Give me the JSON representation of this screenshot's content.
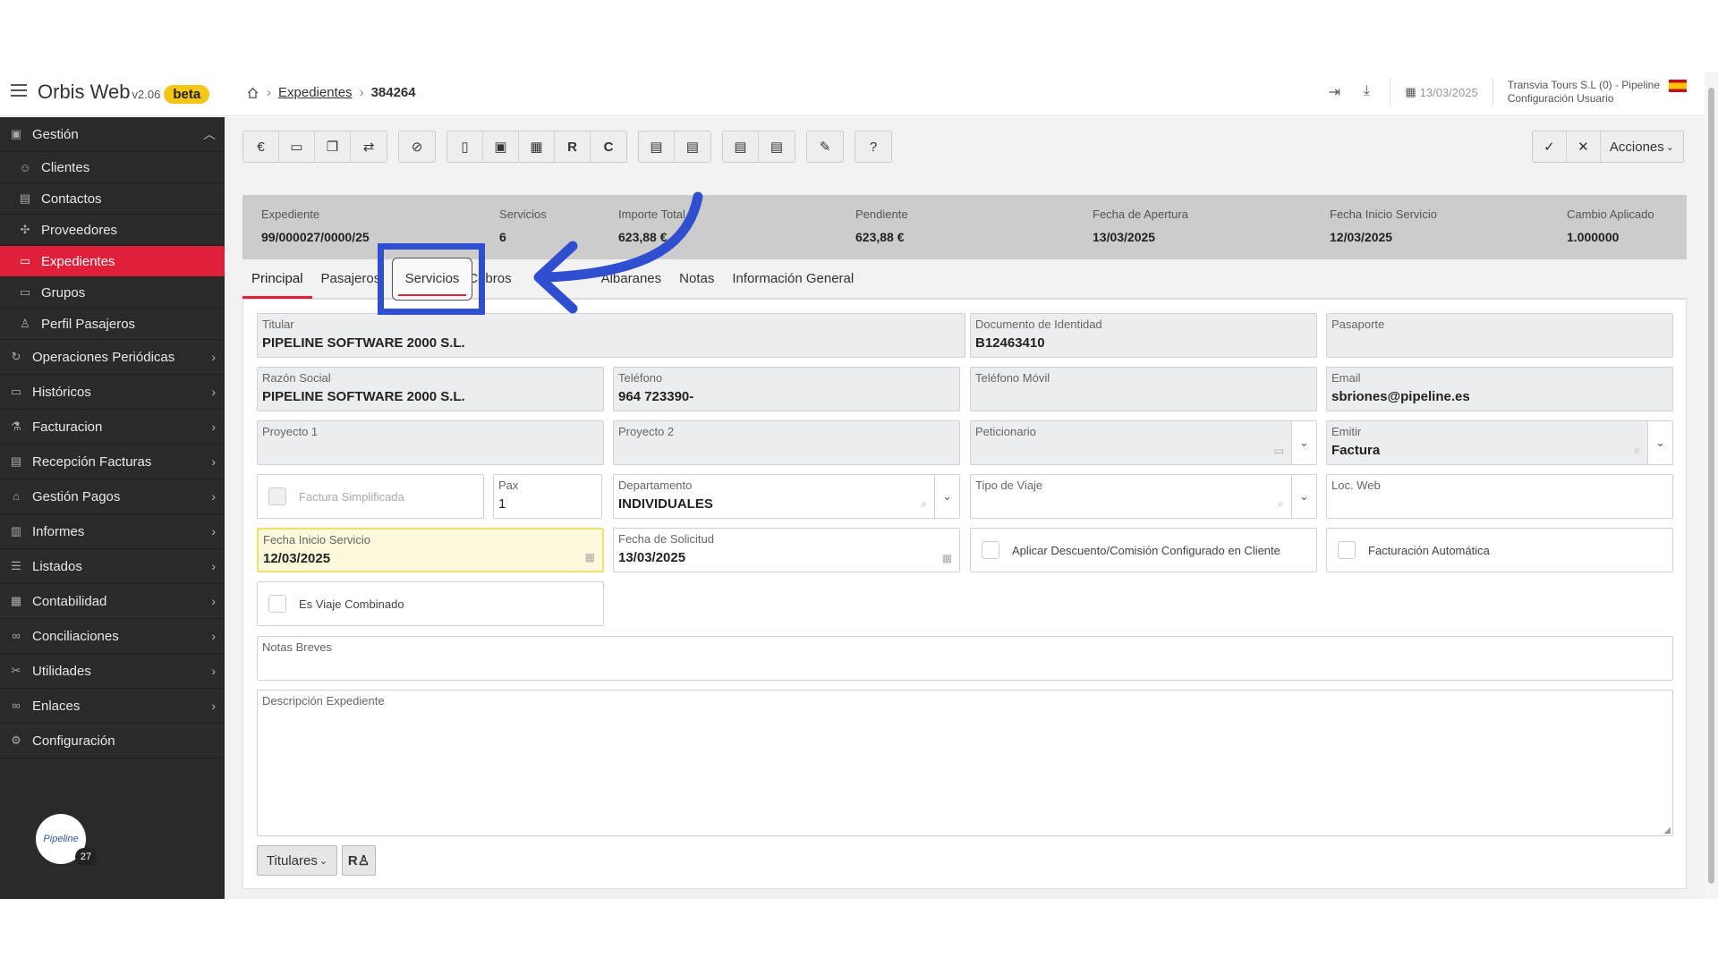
{
  "app": {
    "name": "Orbis Web",
    "version": "v2.06",
    "beta": "beta"
  },
  "breadcrumb": {
    "section": "Expedientes",
    "current": "384264"
  },
  "header": {
    "date": "13/03/2025",
    "company": "Transvia Tours S.L (0) - Pipeline",
    "config": "Configuración Usuario"
  },
  "sidebar": {
    "gestion": "Gestión",
    "sub": [
      {
        "label": "Clientes",
        "icon": "users-icon"
      },
      {
        "label": "Contactos",
        "icon": "contacts-icon"
      },
      {
        "label": "Proveedores",
        "icon": "suppliers-icon"
      },
      {
        "label": "Expedientes",
        "icon": "folder-icon"
      },
      {
        "label": "Grupos",
        "icon": "folder-icon"
      },
      {
        "label": "Perfil Pasajeros",
        "icon": "user-icon"
      }
    ],
    "items": [
      {
        "label": "Operaciones Periódicas",
        "icon": "cycle-icon"
      },
      {
        "label": "Históricos",
        "icon": "folder-icon"
      },
      {
        "label": "Facturacion",
        "icon": "flask-icon"
      },
      {
        "label": "Recepción Facturas",
        "icon": "inbox-icon"
      },
      {
        "label": "Gestión Pagos",
        "icon": "bank-icon"
      },
      {
        "label": "Informes",
        "icon": "chart-icon"
      },
      {
        "label": "Listados",
        "icon": "list-icon"
      },
      {
        "label": "Contabilidad",
        "icon": "calculator-icon"
      },
      {
        "label": "Conciliaciones",
        "icon": "link-icon"
      },
      {
        "label": "Utilidades",
        "icon": "tools-icon"
      },
      {
        "label": "Enlaces",
        "icon": "link-icon"
      },
      {
        "label": "Configuración",
        "icon": "gear-icon"
      }
    ],
    "avatar_text": "Pipeline",
    "badge": "27"
  },
  "toolbar": {
    "r": "R",
    "c": "C",
    "euro": "€",
    "acciones": "Acciones"
  },
  "summary": [
    {
      "label": "Expediente",
      "value": "99/000027/0000/25"
    },
    {
      "label": "Servicios",
      "value": "6"
    },
    {
      "label": "Importe Total",
      "value": "623,88 €"
    },
    {
      "label": "Pendiente",
      "value": "623,88 €"
    },
    {
      "label": "Fecha de Apertura",
      "value": "13/03/2025"
    },
    {
      "label": "Fecha Inicio Servicio",
      "value": "12/03/2025"
    },
    {
      "label": "Cambio Aplicado",
      "value": "1.000000"
    }
  ],
  "tabs": [
    "Principal",
    "Pasajeros",
    "Servicios",
    "Cobros",
    "Albaranes",
    "Notas",
    "Información General"
  ],
  "form": {
    "titular_label": "Titular",
    "titular": "PIPELINE SOFTWARE 2000 S.L.",
    "doc_label": "Documento de Identidad",
    "doc": "B12463410",
    "pasaporte_label": "Pasaporte",
    "razon_label": "Razón Social",
    "razon": "PIPELINE SOFTWARE 2000 S.L.",
    "telefono_label": "Teléfono",
    "telefono": "964 723390-",
    "movil_label": "Teléfono Móvil",
    "email_label": "Email",
    "email": "sbriones@pipeline.es",
    "proyecto1_label": "Proyecto 1",
    "proyecto2_label": "Proyecto 2",
    "peticionario_label": "Peticionario",
    "emitir_label": "Emitir",
    "emitir": "Factura",
    "factura_simplificada": "Factura Simplificada",
    "pax_label": "Pax",
    "pax": "1",
    "departamento_label": "Departamento",
    "departamento": "INDIVIDUALES",
    "tipo_viaje_label": "Tipo de Viaje",
    "loc_web_label": "Loc. Web",
    "fecha_inicio_label": "Fecha Inicio Servicio",
    "fecha_inicio": "12/03/2025",
    "fecha_solicitud_label": "Fecha de Solicitud",
    "fecha_solicitud": "13/03/2025",
    "aplicar_descuento": "Aplicar Descuento/Comisión Configurado en Cliente",
    "facturacion_auto": "Facturación Automática",
    "viaje_combinado": "Es Viaje Combinado",
    "notas_label": "Notas Breves",
    "descripcion_label": "Descripción Expediente",
    "titulares_button": "Titulares"
  },
  "colors": {
    "accent": "#e0203a",
    "highlight": "#2f4fd0",
    "sidebar": "#2a2a2a"
  }
}
